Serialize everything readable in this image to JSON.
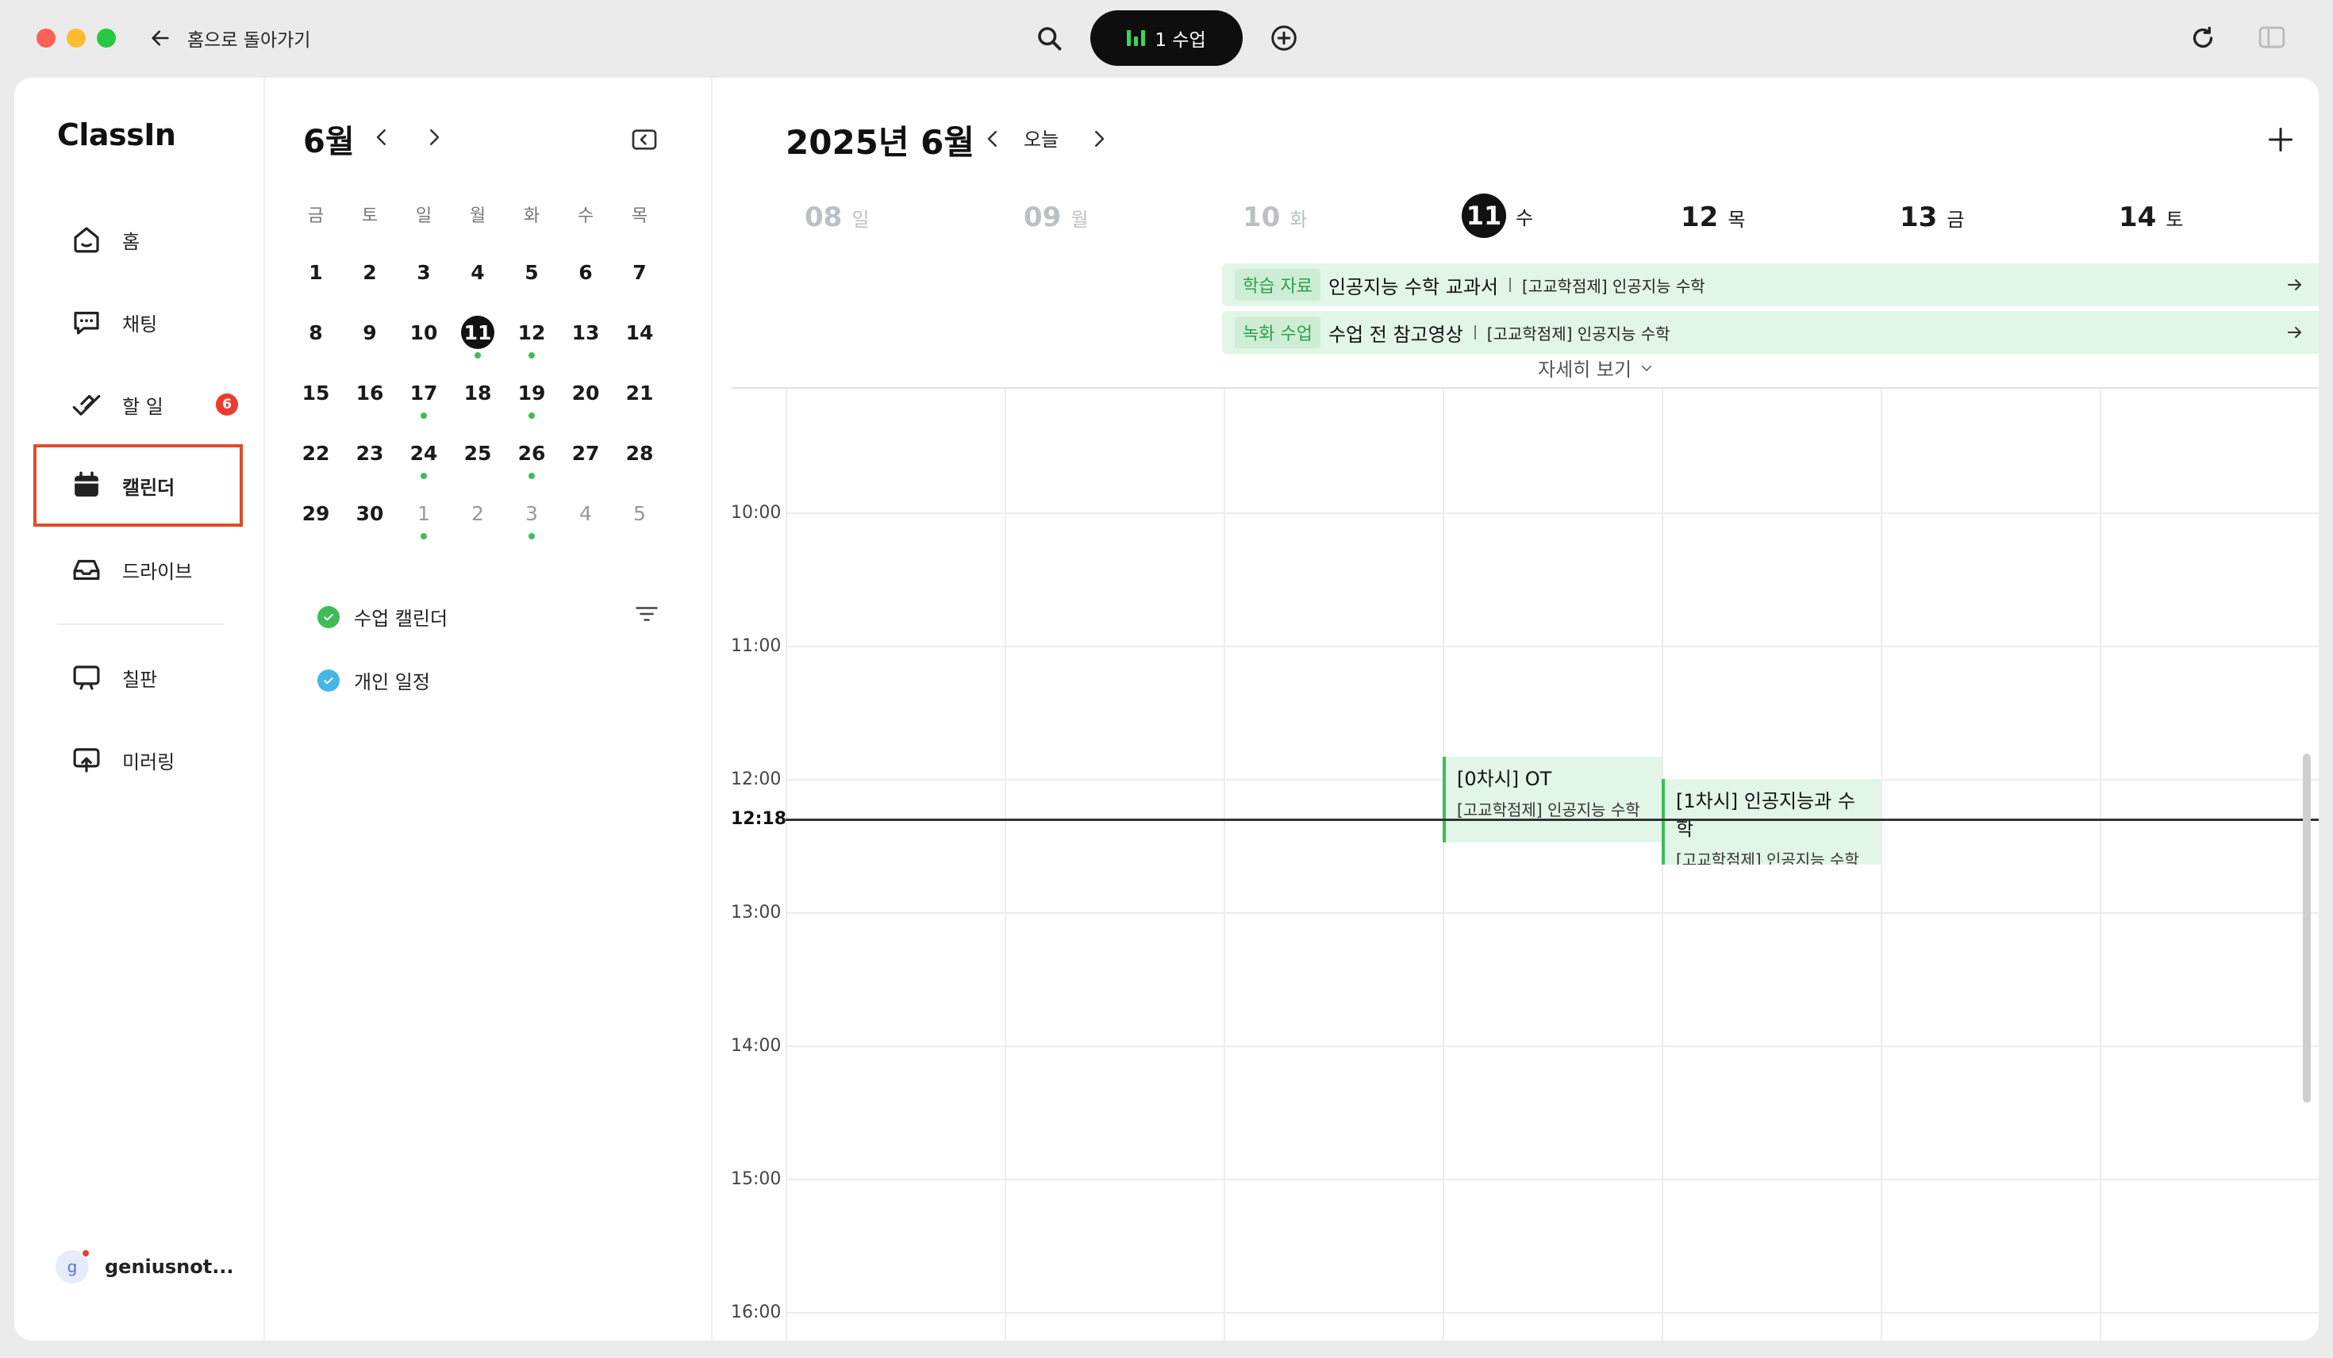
{
  "titlebar": {
    "back_label": "홈으로 돌아가기",
    "class_pill_label": "1 수업"
  },
  "nav": {
    "logo": "ClassIn",
    "items": [
      {
        "label": "홈",
        "icon": "home-icon"
      },
      {
        "label": "채팅",
        "icon": "chat-icon"
      },
      {
        "label": "할 일",
        "icon": "todo-icon",
        "badge": "6"
      },
      {
        "label": "캘린더",
        "icon": "calendar-icon",
        "active": true
      },
      {
        "label": "드라이브",
        "icon": "drive-icon"
      },
      {
        "label": "칠판",
        "icon": "blackboard-icon"
      },
      {
        "label": "미러링",
        "icon": "mirroring-icon"
      }
    ],
    "user": {
      "avatar_letter": "g",
      "name": "geniusnot..."
    }
  },
  "mini_calendar": {
    "title": "6월",
    "weekdays": [
      "금",
      "토",
      "일",
      "월",
      "화",
      "수",
      "목"
    ],
    "weeks": [
      [
        {
          "d": "1"
        },
        {
          "d": "2"
        },
        {
          "d": "3"
        },
        {
          "d": "4"
        },
        {
          "d": "5"
        },
        {
          "d": "6"
        },
        {
          "d": "7"
        }
      ],
      [
        {
          "d": "8"
        },
        {
          "d": "9"
        },
        {
          "d": "10"
        },
        {
          "d": "11",
          "today": true,
          "dot": true
        },
        {
          "d": "12",
          "dot": true
        },
        {
          "d": "13"
        },
        {
          "d": "14"
        }
      ],
      [
        {
          "d": "15"
        },
        {
          "d": "16"
        },
        {
          "d": "17",
          "dot": true
        },
        {
          "d": "18"
        },
        {
          "d": "19",
          "dot": true
        },
        {
          "d": "20"
        },
        {
          "d": "21"
        }
      ],
      [
        {
          "d": "22"
        },
        {
          "d": "23"
        },
        {
          "d": "24",
          "dot": true
        },
        {
          "d": "25"
        },
        {
          "d": "26",
          "dot": true
        },
        {
          "d": "27"
        },
        {
          "d": "28"
        }
      ],
      [
        {
          "d": "29"
        },
        {
          "d": "30"
        },
        {
          "d": "1",
          "other": true,
          "dot": true
        },
        {
          "d": "2",
          "other": true
        },
        {
          "d": "3",
          "other": true,
          "dot": true
        },
        {
          "d": "4",
          "other": true
        },
        {
          "d": "5",
          "other": true
        }
      ]
    ],
    "calendars": [
      {
        "label": "수업 캘린더",
        "color": "#3ebd57"
      },
      {
        "label": "개인 일정",
        "color": "#45b6e6"
      }
    ]
  },
  "main": {
    "title": "2025년 6월",
    "today_label": "오늘",
    "days": [
      {
        "num": "08",
        "name": "일",
        "state": "past"
      },
      {
        "num": "09",
        "name": "월",
        "state": "past"
      },
      {
        "num": "10",
        "name": "화",
        "state": "past"
      },
      {
        "num": "11",
        "name": "수",
        "state": "today"
      },
      {
        "num": "12",
        "name": "목",
        "state": "future"
      },
      {
        "num": "13",
        "name": "금",
        "state": "future"
      },
      {
        "num": "14",
        "name": "토",
        "state": "future"
      }
    ],
    "allday_events": [
      {
        "tag": "학습 자료",
        "title": "인공지능 수학 교과서",
        "sub": "[고교학점제] 인공지능 수학"
      },
      {
        "tag": "녹화 수업",
        "title": "수업 전 참고영상",
        "sub": "[고교학점제] 인공지능 수학"
      }
    ],
    "more_label": "자세히 보기",
    "hours": [
      "10:00",
      "11:00",
      "12:00",
      "13:00",
      "14:00",
      "15:00",
      "16:00"
    ],
    "now_label": "12:18",
    "events": [
      {
        "title": "[0차시] OT",
        "sub": "[고교학점제] 인공지능 수학",
        "day": 3
      },
      {
        "title": "[1차시] 인공지능과 수학",
        "sub": "[고교학점제] 인공지능 수학",
        "day": 4
      }
    ]
  },
  "colors": {
    "accent_green": "#3ebd57",
    "event_bg": "#e1f6e6",
    "active_outline": "#e14b2b",
    "badge_red": "#ee3b32"
  }
}
